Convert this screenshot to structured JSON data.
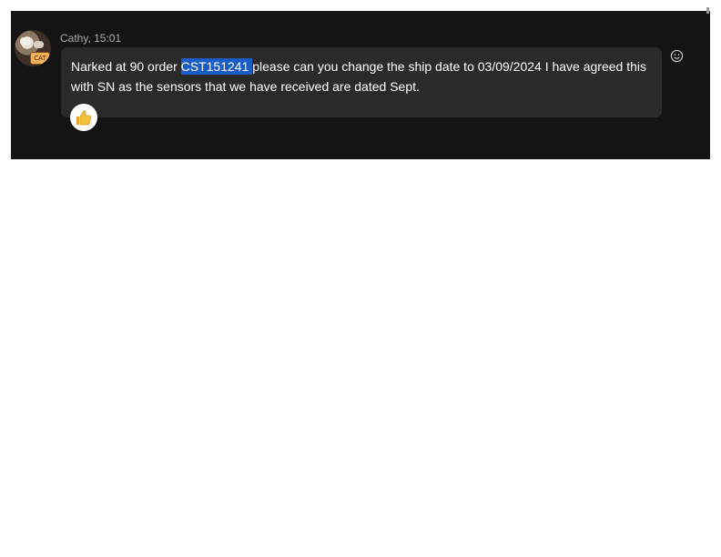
{
  "message": {
    "sender": "Cathy",
    "time": "15:01",
    "header_text": "Cathy, 15:01",
    "text_before": "Narked at 90 order ",
    "highlighted": "CST151241 ",
    "text_after": " please can you change the ship date to 03/09/2024  I have agreed this with SN as the sensors that we have received are dated Sept.",
    "reaction_icon": "thumbs-up-icon",
    "avatar_badge": "CAT"
  },
  "actions": {
    "emoji_icon": "smiley-icon"
  },
  "colors": {
    "panel": "#141415",
    "bubble": "#2a2a2b",
    "selection": "#1a5dc7",
    "meta_text": "#a8a8a8"
  }
}
